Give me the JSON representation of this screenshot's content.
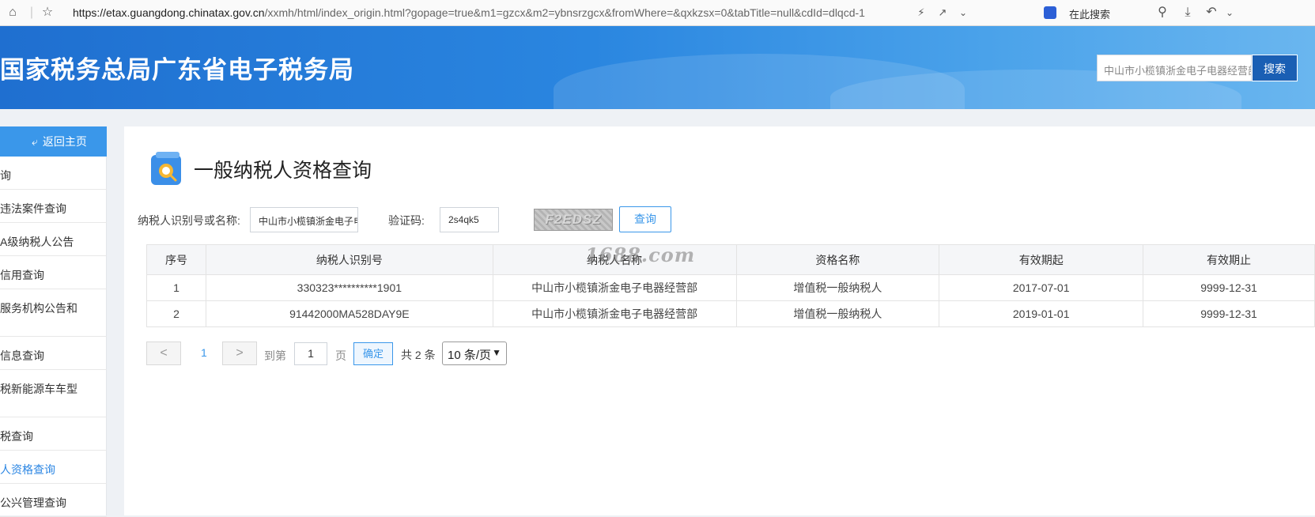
{
  "browser": {
    "url_main": "https://etax.guangdong.chinatax.gov.cn",
    "url_rest": "/xxmh/html/index_origin.html?gopage=true&m1=gzcx&m2=ybnsrzgcx&fromWhere=&qxkzsx=0&tabTitle=null&cdId=dlqcd-1",
    "search_label": "在此搜索"
  },
  "header": {
    "title": "国家税务总局广东省电子税务局",
    "search_value": "中山市小榄镇浙金电子电器经营部",
    "search_button": "搜索"
  },
  "sidebar": {
    "back_label": "返回主页",
    "items": [
      {
        "label": "询"
      },
      {
        "label": "违法案件查询"
      },
      {
        "label": "A级纳税人公告"
      },
      {
        "label": "信用查询"
      },
      {
        "label": "服务机构公告和"
      },
      {
        "label": "信息查询"
      },
      {
        "label": "税新能源车车型"
      },
      {
        "label": "税查询"
      },
      {
        "label": "人资格查询"
      },
      {
        "label": "公兴管理查询"
      }
    ]
  },
  "main": {
    "page_title": "一般纳税人资格查询",
    "taxpayer_label": "纳税人识别号或名称:",
    "taxpayer_value": "中山市小榄镇浙金电子电器经营部",
    "captcha_label": "验证码:",
    "captcha_value": "2s4qk5",
    "captcha_image_text": "F2EDSZ",
    "query_button": "查询",
    "watermark": "1688.com"
  },
  "table": {
    "headers": [
      "序号",
      "纳税人识别号",
      "纳税人名称",
      "资格名称",
      "有效期起",
      "有效期止"
    ],
    "rows": [
      [
        "1",
        "330323**********1901",
        "中山市小榄镇浙金电子电器经营部",
        "增值税一般纳税人",
        "2017-07-01",
        "9999-12-31"
      ],
      [
        "2",
        "91442000MA528DAY9E",
        "中山市小榄镇浙金电子电器经营部",
        "增值税一般纳税人",
        "2019-01-01",
        "9999-12-31"
      ]
    ]
  },
  "pagination": {
    "prev": "<",
    "current_page": "1",
    "next": ">",
    "goto_label": "到第",
    "goto_value": "1",
    "page_unit": "页",
    "confirm": "确定",
    "total": "共 2 条",
    "page_size": "10 条/页"
  },
  "colors": {
    "accent": "#3a97ea",
    "header_dark": "#1f6fd0",
    "search_button": "#1a5fb4"
  }
}
